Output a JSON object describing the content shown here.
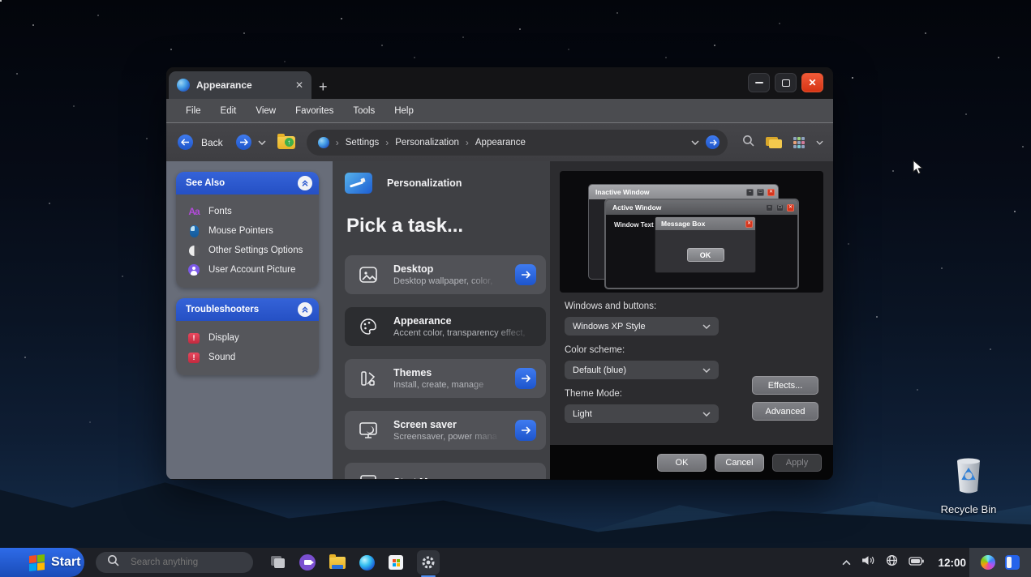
{
  "window": {
    "tab_title": "Appearance",
    "menu": [
      "File",
      "Edit",
      "View",
      "Favorites",
      "Tools",
      "Help"
    ],
    "navbar": {
      "back_label": "Back",
      "breadcrumb": [
        "Settings",
        "Personalization",
        "Appearance"
      ]
    },
    "sidebar": {
      "see_also": {
        "title": "See Also",
        "items": [
          {
            "label": "Fonts"
          },
          {
            "label": "Mouse Pointers"
          },
          {
            "label": "Other Settings Options"
          },
          {
            "label": "User Account Picture"
          }
        ]
      },
      "troubleshooters": {
        "title": "Troubleshooters",
        "items": [
          {
            "label": "Display"
          },
          {
            "label": "Sound"
          }
        ]
      }
    },
    "main": {
      "header": "Personalization",
      "heading": "Pick a task...",
      "tasks": [
        {
          "title": "Desktop",
          "subtitle": "Desktop wallpaper, color,"
        },
        {
          "title": "Appearance",
          "subtitle": "Accent color, transparency effect,"
        },
        {
          "title": "Themes",
          "subtitle": "Install, create, manage"
        },
        {
          "title": "Screen saver",
          "subtitle": "Screensaver, power mana"
        },
        {
          "title": "Start Menu",
          "subtitle": ""
        }
      ]
    },
    "panel": {
      "preview": {
        "inactive_title": "Inactive Window",
        "active_title": "Active Window",
        "window_text": "Window Text",
        "message_box_title": "Message Box",
        "ok_label": "OK"
      },
      "windows_buttons_label": "Windows and buttons:",
      "windows_buttons_value": "Windows XP Style",
      "color_scheme_label": "Color scheme:",
      "color_scheme_value": "Default (blue)",
      "theme_mode_label": "Theme Mode:",
      "theme_mode_value": "Light",
      "effects_label": "Effects...",
      "advanced_label": "Advanced"
    },
    "footer": {
      "ok": "OK",
      "cancel": "Cancel",
      "apply": "Apply"
    }
  },
  "desktop": {
    "recycle_bin_label": "Recycle Bin"
  },
  "taskbar": {
    "start_label": "Start",
    "search_placeholder": "Search anything",
    "clock": "12:00"
  },
  "colors": {
    "accent_blue": "#2f6ae0",
    "header_blue": "#2a57cf",
    "close_red": "#d6351c"
  }
}
